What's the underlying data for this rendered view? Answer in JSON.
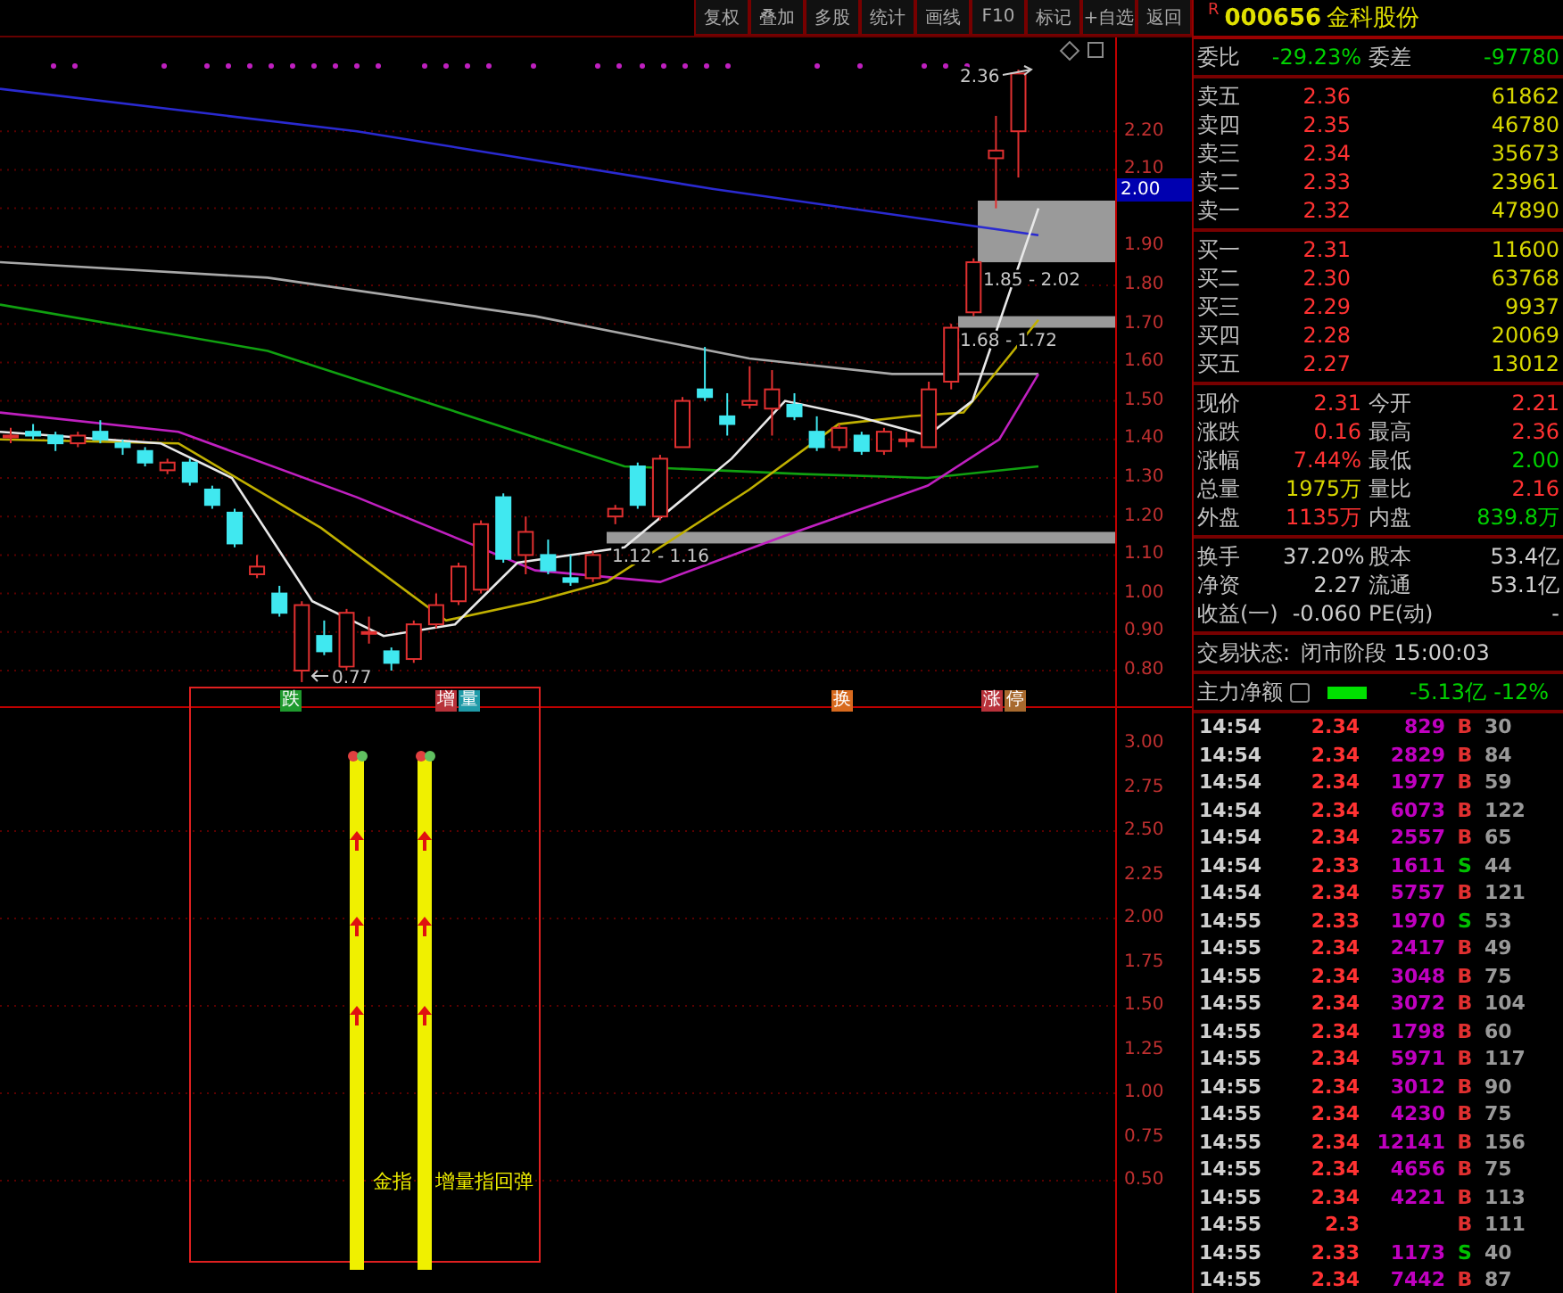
{
  "toolbar": {
    "buttons": [
      "复权",
      "叠加",
      "多股",
      "统计",
      "画线",
      "F10",
      "标记",
      "+自选",
      "返回"
    ]
  },
  "stock": {
    "badge": "R",
    "code": "000656",
    "name": "金科股份"
  },
  "main_chart": {
    "axis_labels": [
      "2.20",
      "2.10",
      "1.90",
      "1.80",
      "1.70",
      "1.60",
      "1.50",
      "1.40",
      "1.30",
      "1.20",
      "1.10",
      "1.00",
      "0.90",
      "0.80"
    ],
    "current_price": "2.00",
    "annotations": [
      "2.36",
      "1.85 - 2.02",
      "1.68 - 1.72",
      "1.12 - 1.16",
      "0.77"
    ]
  },
  "sub_chart": {
    "axis_labels": [
      "3.00",
      "2.75",
      "2.50",
      "2.25",
      "2.00",
      "1.75",
      "1.50",
      "1.25",
      "1.00",
      "0.75",
      "0.50"
    ],
    "signals": [
      {
        "text": "跌",
        "color": "#1f9a2e"
      },
      {
        "text": "增",
        "color": "#b8323a"
      },
      {
        "text": "量",
        "color": "#1f9aa8"
      },
      {
        "text": "换",
        "color": "#d86a1e"
      },
      {
        "text": "涨",
        "color": "#b8323a"
      },
      {
        "text": "停",
        "color": "#a86a2e"
      }
    ],
    "captions": [
      "金指",
      "增量指回弹"
    ]
  },
  "order_book": {
    "ratio_label": "委比",
    "ratio": "-29.23%",
    "diff_label": "委差",
    "diff": "-97780",
    "asks": [
      {
        "label": "卖五",
        "price": "2.36",
        "volume": "61862"
      },
      {
        "label": "卖四",
        "price": "2.35",
        "volume": "46780"
      },
      {
        "label": "卖三",
        "price": "2.34",
        "volume": "35673"
      },
      {
        "label": "卖二",
        "price": "2.33",
        "volume": "23961"
      },
      {
        "label": "卖一",
        "price": "2.32",
        "volume": "47890"
      }
    ],
    "bids": [
      {
        "label": "买一",
        "price": "2.31",
        "volume": "11600"
      },
      {
        "label": "买二",
        "price": "2.30",
        "volume": "63768"
      },
      {
        "label": "买三",
        "price": "2.29",
        "volume": "9937"
      },
      {
        "label": "买四",
        "price": "2.28",
        "volume": "20069"
      },
      {
        "label": "买五",
        "price": "2.27",
        "volume": "13012"
      }
    ]
  },
  "quote": [
    {
      "cells": [
        {
          "label": "现价",
          "value": "2.31",
          "color": "#ff3232"
        },
        {
          "label": "今开",
          "value": "2.21",
          "color": "#ff3232"
        }
      ]
    },
    {
      "cells": [
        {
          "label": "涨跌",
          "value": "0.16",
          "color": "#ff3232"
        },
        {
          "label": "最高",
          "value": "2.36",
          "color": "#ff3232"
        }
      ]
    },
    {
      "cells": [
        {
          "label": "涨幅",
          "value": "7.44%",
          "color": "#ff3232"
        },
        {
          "label": "最低",
          "value": "2.00",
          "color": "#00d000"
        }
      ]
    },
    {
      "cells": [
        {
          "label": "总量",
          "value": "1975万",
          "color": "#d8d800"
        },
        {
          "label": "量比",
          "value": "2.16",
          "color": "#ff3232"
        }
      ]
    },
    {
      "cells": [
        {
          "label": "外盘",
          "value": "1135万",
          "color": "#ff3232"
        },
        {
          "label": "内盘",
          "value": "839.8万",
          "color": "#00d000"
        }
      ]
    }
  ],
  "fundamentals": [
    {
      "label": "换手",
      "value": "37.20%",
      "label2": "股本",
      "value2": "53.4亿"
    },
    {
      "label": "净资",
      "value": "2.27",
      "label2": "流通",
      "value2": "53.1亿"
    },
    {
      "label": "收益(一)",
      "value": "-0.060",
      "label2": "PE(动)",
      "value2": "-"
    }
  ],
  "status": {
    "label": "交易状态:",
    "value": "闭市阶段",
    "time": "15:00:03"
  },
  "main_flow": {
    "label": "主力净额",
    "amount": "-5.13亿",
    "percent": "-12%"
  },
  "trades": [
    {
      "time": "14:54",
      "price": "2.34",
      "volume": "829",
      "side": "B",
      "color": "#e03030",
      "extra": "30"
    },
    {
      "time": "14:54",
      "price": "2.34",
      "volume": "2829",
      "side": "B",
      "color": "#e03030",
      "extra": "84"
    },
    {
      "time": "14:54",
      "price": "2.34",
      "volume": "1977",
      "side": "B",
      "color": "#e03030",
      "extra": "59"
    },
    {
      "time": "14:54",
      "price": "2.34",
      "volume": "6073",
      "side": "B",
      "color": "#e03030",
      "extra": "122"
    },
    {
      "time": "14:54",
      "price": "2.34",
      "volume": "2557",
      "side": "B",
      "color": "#e03030",
      "extra": "65"
    },
    {
      "time": "14:54",
      "price": "2.33",
      "volume": "1611",
      "side": "S",
      "color": "#00c000",
      "extra": "44"
    },
    {
      "time": "14:54",
      "price": "2.34",
      "volume": "5757",
      "side": "B",
      "color": "#e03030",
      "extra": "121"
    },
    {
      "time": "14:55",
      "price": "2.33",
      "volume": "1970",
      "side": "S",
      "color": "#00c000",
      "extra": "53"
    },
    {
      "time": "14:55",
      "price": "2.34",
      "volume": "2417",
      "side": "B",
      "color": "#e03030",
      "extra": "49"
    },
    {
      "time": "14:55",
      "price": "2.34",
      "volume": "3048",
      "side": "B",
      "color": "#e03030",
      "extra": "75"
    },
    {
      "time": "14:55",
      "price": "2.34",
      "volume": "3072",
      "side": "B",
      "color": "#e03030",
      "extra": "104"
    },
    {
      "time": "14:55",
      "price": "2.34",
      "volume": "1798",
      "side": "B",
      "color": "#e03030",
      "extra": "60"
    },
    {
      "time": "14:55",
      "price": "2.34",
      "volume": "5971",
      "side": "B",
      "color": "#e03030",
      "extra": "117"
    },
    {
      "time": "14:55",
      "price": "2.34",
      "volume": "3012",
      "side": "B",
      "color": "#e03030",
      "extra": "90"
    },
    {
      "time": "14:55",
      "price": "2.34",
      "volume": "4230",
      "side": "B",
      "color": "#e03030",
      "extra": "75"
    },
    {
      "time": "14:55",
      "price": "2.34",
      "volume": "12141",
      "side": "B",
      "color": "#e03030",
      "extra": "156"
    },
    {
      "time": "14:55",
      "price": "2.34",
      "volume": "4656",
      "side": "B",
      "color": "#e03030",
      "extra": "75"
    },
    {
      "time": "14:55",
      "price": "2.34",
      "volume": "4221",
      "side": "B",
      "color": "#e03030",
      "extra": "113"
    },
    {
      "time": "14:55",
      "price": "2.3",
      "side": "B",
      "color": "#e03030",
      "extra": "111"
    },
    {
      "time": "14:55",
      "price": "2.33",
      "volume": "1173",
      "side": "S",
      "color": "#00c000",
      "extra": "40"
    },
    {
      "time": "14:55",
      "price": "2.34",
      "volume": "7442",
      "side": "B",
      "color": "#e03030",
      "extra": "87"
    }
  ]
}
